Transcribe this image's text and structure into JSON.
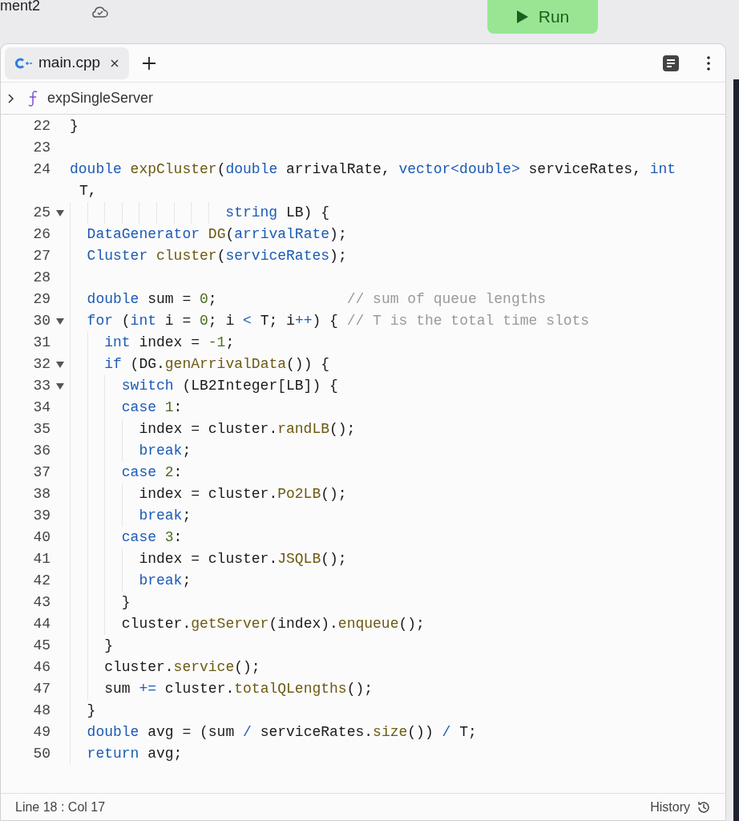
{
  "project": {
    "title": "ment2"
  },
  "run_button": {
    "label": "Run"
  },
  "tabs": [
    {
      "label": "main.cpp",
      "selected": true
    }
  ],
  "breadcrumb": {
    "label": "expSingleServer"
  },
  "lines": [
    {
      "num": "22",
      "foldable": false,
      "kind": "code",
      "segments": [
        {
          "text": "}",
          "kind": "plain"
        }
      ]
    },
    {
      "num": "23",
      "foldable": false,
      "kind": "code"
    },
    {
      "num": "24",
      "foldable": false,
      "kind": "code",
      "segments": [
        {
          "text": "double",
          "kind": "kw"
        },
        {
          "text": " expCluster",
          "kind": "fn"
        },
        {
          "text": "(",
          "kind": "plain"
        },
        {
          "text": "double",
          "kind": "kw"
        },
        {
          "text": " arrivalRate, ",
          "kind": "plain"
        },
        {
          "text": "vector<double>",
          "kind": "kw"
        },
        {
          "text": " serviceRates, ",
          "kind": "plain"
        },
        {
          "text": "int",
          "kind": "kw"
        }
      ],
      "continuation": [
        {
          "text": "T,",
          "kind": "plain"
        }
      ]
    },
    {
      "num": "25",
      "foldable": true,
      "kind": "aligned",
      "segments": [
        {
          "text": "string",
          "kind": "kw"
        },
        {
          "text": " LB) {",
          "kind": "plain"
        }
      ],
      "children": [
        {
          "num": "26",
          "foldable": false,
          "kind": "code",
          "segments": [
            {
              "text": "DataGenerator",
              "kind": "kw"
            },
            {
              "text": " DG",
              "kind": "fn"
            },
            {
              "text": "(",
              "kind": "plain"
            },
            {
              "text": "arrivalRate",
              "kind": "kw"
            },
            {
              "text": ");",
              "kind": "plain"
            }
          ]
        },
        {
          "num": "27",
          "foldable": false,
          "kind": "code",
          "segments": [
            {
              "text": "Cluster",
              "kind": "kw"
            },
            {
              "text": " cluster",
              "kind": "fn"
            },
            {
              "text": "(",
              "kind": "plain"
            },
            {
              "text": "serviceRates",
              "kind": "kw"
            },
            {
              "text": ");",
              "kind": "plain"
            }
          ]
        },
        {
          "num": "28",
          "foldable": false,
          "kind": "code"
        },
        {
          "num": "29",
          "foldable": false,
          "kind": "code",
          "segments": [
            {
              "text": "double",
              "kind": "kw"
            },
            {
              "text": " sum = ",
              "kind": "plain"
            },
            {
              "text": "0",
              "kind": "num"
            },
            {
              "text": ";               ",
              "kind": "plain"
            },
            {
              "text": "// sum of queue lengths",
              "kind": "cm"
            }
          ]
        },
        {
          "num": "30",
          "foldable": true,
          "kind": "code",
          "segments": [
            {
              "text": "for",
              "kind": "kw"
            },
            {
              "text": " (",
              "kind": "plain"
            },
            {
              "text": "int",
              "kind": "kw"
            },
            {
              "text": " i = ",
              "kind": "plain"
            },
            {
              "text": "0",
              "kind": "num"
            },
            {
              "text": "; i ",
              "kind": "plain"
            },
            {
              "text": "<",
              "kind": "op"
            },
            {
              "text": " T; i",
              "kind": "plain"
            },
            {
              "text": "++",
              "kind": "op"
            },
            {
              "text": ") { ",
              "kind": "plain"
            },
            {
              "text": "// T is the total time slots",
              "kind": "cm"
            }
          ],
          "children": [
            {
              "num": "31",
              "foldable": false,
              "kind": "code",
              "segments": [
                {
                  "text": "int",
                  "kind": "kw"
                },
                {
                  "text": " index = ",
                  "kind": "plain"
                },
                {
                  "text": "-1",
                  "kind": "num"
                },
                {
                  "text": ";",
                  "kind": "plain"
                }
              ]
            },
            {
              "num": "32",
              "foldable": true,
              "kind": "code",
              "segments": [
                {
                  "text": "if",
                  "kind": "kw"
                },
                {
                  "text": " (DG.",
                  "kind": "plain"
                },
                {
                  "text": "genArrivalData",
                  "kind": "fn"
                },
                {
                  "text": "()) {",
                  "kind": "plain"
                }
              ],
              "children": [
                {
                  "num": "33",
                  "foldable": true,
                  "kind": "code",
                  "segments": [
                    {
                      "text": "switch",
                      "kind": "kw"
                    },
                    {
                      "text": " (LB2Integer[LB]) {",
                      "kind": "plain"
                    }
                  ]
                },
                {
                  "num": "34",
                  "foldable": false,
                  "kind": "code",
                  "segments": [
                    {
                      "text": "case",
                      "kind": "kw"
                    },
                    {
                      "text": " 1",
                      "kind": "num"
                    },
                    {
                      "text": ":",
                      "kind": "plain"
                    }
                  ],
                  "children": [
                    {
                      "num": "35",
                      "foldable": false,
                      "kind": "code",
                      "segments": [
                        {
                          "text": "index = cluster.",
                          "kind": "plain"
                        },
                        {
                          "text": "randLB",
                          "kind": "fn"
                        },
                        {
                          "text": "();",
                          "kind": "plain"
                        }
                      ]
                    },
                    {
                      "num": "36",
                      "foldable": false,
                      "kind": "code",
                      "segments": [
                        {
                          "text": "break",
                          "kind": "kw"
                        },
                        {
                          "text": ";",
                          "kind": "plain"
                        }
                      ]
                    }
                  ]
                },
                {
                  "num": "37",
                  "foldable": false,
                  "kind": "code",
                  "segments": [
                    {
                      "text": "case",
                      "kind": "kw"
                    },
                    {
                      "text": " 2",
                      "kind": "num"
                    },
                    {
                      "text": ":",
                      "kind": "plain"
                    }
                  ],
                  "children": [
                    {
                      "num": "38",
                      "foldable": false,
                      "kind": "code",
                      "segments": [
                        {
                          "text": "index = cluster.",
                          "kind": "plain"
                        },
                        {
                          "text": "Po2LB",
                          "kind": "fn"
                        },
                        {
                          "text": "();",
                          "kind": "plain"
                        }
                      ]
                    },
                    {
                      "num": "39",
                      "foldable": false,
                      "kind": "code",
                      "segments": [
                        {
                          "text": "break",
                          "kind": "kw"
                        },
                        {
                          "text": ";",
                          "kind": "plain"
                        }
                      ]
                    }
                  ]
                },
                {
                  "num": "40",
                  "foldable": false,
                  "kind": "code",
                  "segments": [
                    {
                      "text": "case",
                      "kind": "kw"
                    },
                    {
                      "text": " 3",
                      "kind": "num"
                    },
                    {
                      "text": ":",
                      "kind": "plain"
                    }
                  ],
                  "children": [
                    {
                      "num": "41",
                      "foldable": false,
                      "kind": "code",
                      "segments": [
                        {
                          "text": "index = cluster.",
                          "kind": "plain"
                        },
                        {
                          "text": "JSQLB",
                          "kind": "fn"
                        },
                        {
                          "text": "();",
                          "kind": "plain"
                        }
                      ]
                    },
                    {
                      "num": "42",
                      "foldable": false,
                      "kind": "code",
                      "segments": [
                        {
                          "text": "break",
                          "kind": "kw"
                        },
                        {
                          "text": ";",
                          "kind": "plain"
                        }
                      ]
                    }
                  ]
                },
                {
                  "num": "43",
                  "foldable": false,
                  "kind": "code",
                  "segments": [
                    {
                      "text": "}",
                      "kind": "plain"
                    }
                  ]
                },
                {
                  "num": "44",
                  "foldable": false,
                  "kind": "code",
                  "segments": [
                    {
                      "text": "cluster.",
                      "kind": "plain"
                    },
                    {
                      "text": "getServer",
                      "kind": "fn"
                    },
                    {
                      "text": "(index).",
                      "kind": "plain"
                    },
                    {
                      "text": "enqueue",
                      "kind": "fn"
                    },
                    {
                      "text": "();",
                      "kind": "plain"
                    }
                  ]
                }
              ]
            },
            {
              "num": "45",
              "foldable": false,
              "kind": "code",
              "segments": [
                {
                  "text": "}",
                  "kind": "plain"
                }
              ]
            },
            {
              "num": "46",
              "foldable": false,
              "kind": "code",
              "segments": [
                {
                  "text": "cluster.",
                  "kind": "plain"
                },
                {
                  "text": "service",
                  "kind": "fn"
                },
                {
                  "text": "();",
                  "kind": "plain"
                }
              ]
            },
            {
              "num": "47",
              "foldable": false,
              "kind": "code",
              "segments": [
                {
                  "text": "sum ",
                  "kind": "plain"
                },
                {
                  "text": "+=",
                  "kind": "op"
                },
                {
                  "text": " cluster.",
                  "kind": "plain"
                },
                {
                  "text": "totalQLengths",
                  "kind": "fn"
                },
                {
                  "text": "();",
                  "kind": "plain"
                }
              ]
            }
          ]
        },
        {
          "num": "48",
          "foldable": false,
          "kind": "code",
          "segments": [
            {
              "text": "}",
              "kind": "plain"
            }
          ]
        },
        {
          "num": "49",
          "foldable": false,
          "kind": "code",
          "segments": [
            {
              "text": "double",
              "kind": "kw"
            },
            {
              "text": " avg = (sum ",
              "kind": "plain"
            },
            {
              "text": "/",
              "kind": "op"
            },
            {
              "text": " serviceRates.",
              "kind": "plain"
            },
            {
              "text": "size",
              "kind": "fn"
            },
            {
              "text": "()) ",
              "kind": "plain"
            },
            {
              "text": "/",
              "kind": "op"
            },
            {
              "text": " T;",
              "kind": "plain"
            }
          ]
        },
        {
          "num": "50",
          "foldable": false,
          "kind": "code",
          "segments": [
            {
              "text": "return",
              "kind": "kw"
            },
            {
              "text": " avg;",
              "kind": "plain"
            }
          ]
        }
      ]
    }
  ],
  "status_bar": {
    "position": "Line 18 : Col 17",
    "history": "History"
  }
}
